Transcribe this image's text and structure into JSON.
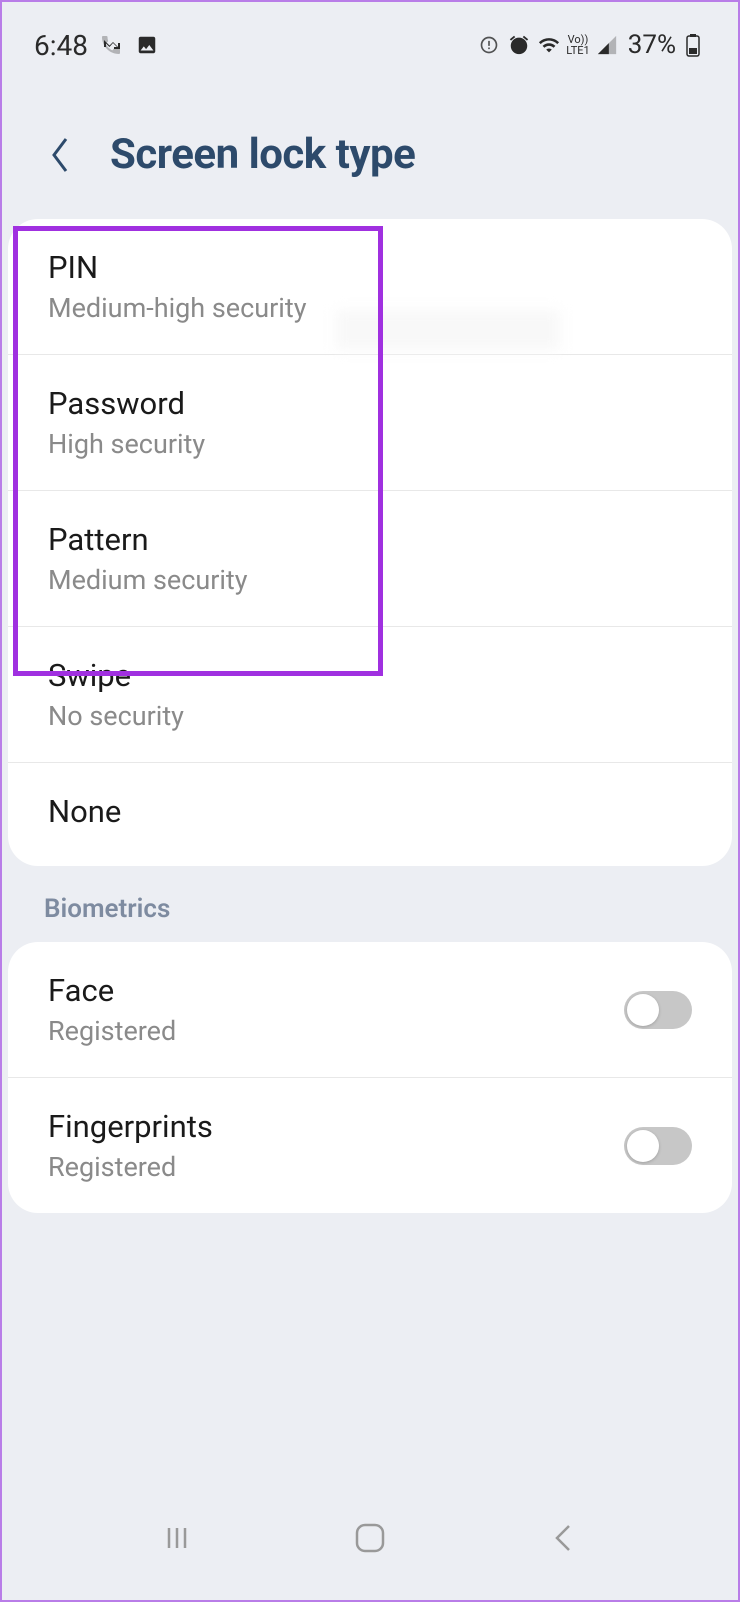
{
  "status_bar": {
    "time": "6:48",
    "battery": "37%"
  },
  "header": {
    "title": "Screen lock type"
  },
  "lock_options": {
    "pin": {
      "title": "PIN",
      "subtitle": "Medium-high security"
    },
    "password": {
      "title": "Password",
      "subtitle": "High security"
    },
    "pattern": {
      "title": "Pattern",
      "subtitle": "Medium security"
    },
    "swipe": {
      "title": "Swipe",
      "subtitle": "No security"
    },
    "none": {
      "title": "None"
    }
  },
  "biometrics": {
    "label": "Biometrics",
    "face": {
      "title": "Face",
      "subtitle": "Registered",
      "enabled": false
    },
    "fingerprints": {
      "title": "Fingerprints",
      "subtitle": "Registered",
      "enabled": false
    }
  }
}
